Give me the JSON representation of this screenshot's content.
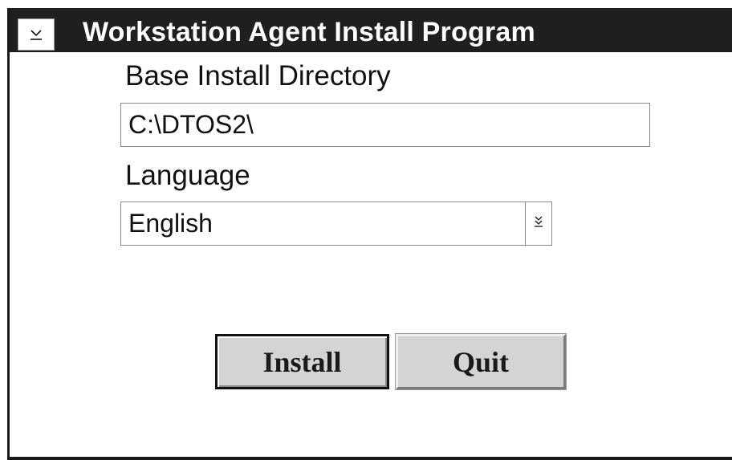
{
  "window": {
    "title": "Workstation Agent Install Program",
    "system_menu_icon": "chevron-underline-icon"
  },
  "form": {
    "directory_label": "Base Install Directory",
    "directory_value": "C:\\DTOS2\\",
    "language_label": "Language",
    "language_value": "English",
    "language_dropdown_icon": "double-chevron-down-icon"
  },
  "buttons": {
    "install_label": "Install",
    "quit_label": "Quit"
  },
  "colors": {
    "titlebar": "#1f1f1f",
    "button_face": "#d4d4d4"
  }
}
